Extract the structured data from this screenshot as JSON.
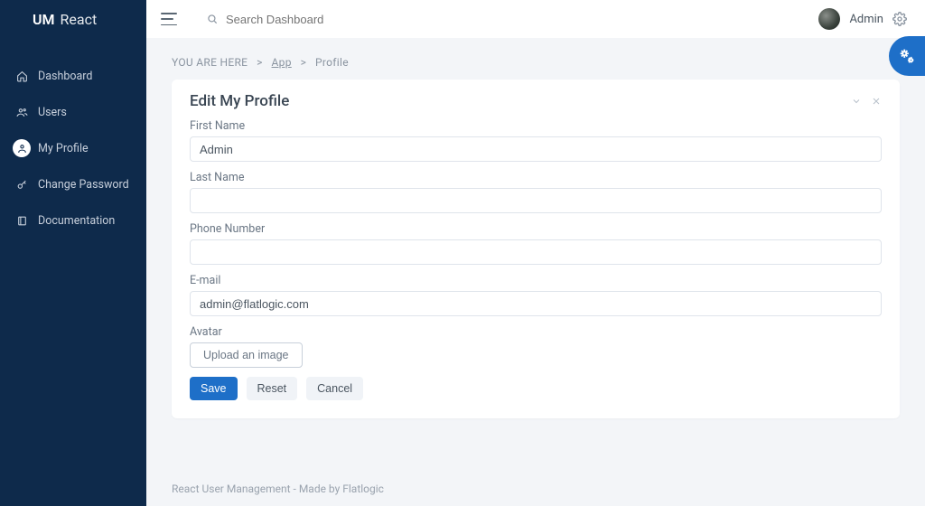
{
  "brand": {
    "um": "UM",
    "react": "React"
  },
  "sidebar": {
    "items": [
      {
        "label": "Dashboard",
        "icon": "home"
      },
      {
        "label": "Users",
        "icon": "users"
      },
      {
        "label": "My Profile",
        "icon": "person",
        "active": true
      },
      {
        "label": "Change Password",
        "icon": "key"
      },
      {
        "label": "Documentation",
        "icon": "book"
      }
    ]
  },
  "topbar": {
    "search_placeholder": "Search Dashboard",
    "user_name": "Admin"
  },
  "breadcrumb": {
    "prefix": "YOU ARE HERE",
    "sep": ">",
    "items": [
      {
        "label": "App",
        "link": true
      },
      {
        "label": "Profile",
        "link": false
      }
    ]
  },
  "card": {
    "title": "Edit My Profile"
  },
  "form": {
    "first_name": {
      "label": "First Name",
      "value": "Admin"
    },
    "last_name": {
      "label": "Last Name",
      "value": ""
    },
    "phone": {
      "label": "Phone Number",
      "value": ""
    },
    "email": {
      "label": "E-mail",
      "value": "admin@flatlogic.com"
    },
    "avatar": {
      "label": "Avatar",
      "button": "Upload an image"
    }
  },
  "buttons": {
    "save": "Save",
    "reset": "Reset",
    "cancel": "Cancel"
  },
  "footer": "React User Management - Made by Flatlogic"
}
